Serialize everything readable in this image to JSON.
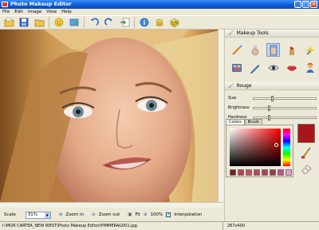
{
  "window": {
    "title": "Photo Makeup Editor"
  },
  "menu": [
    "File",
    "Edit",
    "Image",
    "View",
    "Help"
  ],
  "toolbar": [
    "open-icon",
    "save-icon",
    "folder-icon",
    "smiley-icon",
    "export-icon",
    "undo-icon",
    "redo-icon",
    "import-icon",
    "info-icon",
    "coins-icon",
    "box-icon"
  ],
  "panel": {
    "title": "Makeup Tools",
    "tools": [
      "brush-icon",
      "powder-icon",
      "foundation-icon",
      "lipstick-icon",
      "sparkle-icon",
      "palette-icon",
      "pencil-icon",
      "eye-icon",
      "lips-icon",
      "person-icon"
    ],
    "selected_tool": 2,
    "section": "Rouge",
    "size_label": "Size",
    "size_value": 0.28,
    "brightness_label": "Brightness",
    "brightness_value": 0.23,
    "hardness_label": "Hardness",
    "hardness_value": 0.23
  },
  "colors": {
    "tab_colors": "Colors",
    "tab_brush": "Brush",
    "current": "#a8161a",
    "swatches": [
      "#7a1a2a",
      "#c93a4e",
      "#d64a62",
      "#c0405a",
      "#b83a52",
      "#a83450",
      "#c84a8a",
      "#e89ad8"
    ]
  },
  "bottom": {
    "scale_label": "Scale",
    "scale_value": "31%",
    "zoom_in": "Zoom in",
    "zoom_out": "Zoom out",
    "fit": "Fit",
    "full": "100%",
    "interpolation": "Interpolation"
  },
  "status": {
    "path": "I:\\MOR CARTEA_NEW WEST\\Photo Makeup Editor\\PIMMERAG001.jpg",
    "size": "267x400"
  }
}
